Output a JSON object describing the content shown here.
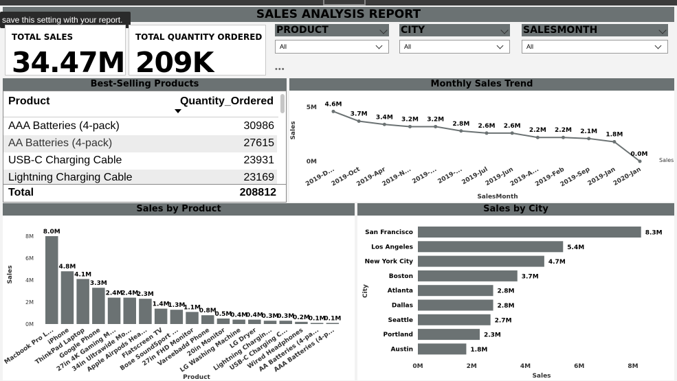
{
  "report": {
    "title": "SALES ANALYSIS REPORT"
  },
  "tooltip": {
    "text": "save this setting with your report."
  },
  "kpis": [
    {
      "label": "TOTAL SALES",
      "value": "34.47M"
    },
    {
      "label": "TOTAL QUANTITY ORDERED",
      "value": "209K"
    }
  ],
  "slicers": [
    {
      "label": "PRODUCT",
      "value": "All"
    },
    {
      "label": "CITY",
      "value": "All"
    },
    {
      "label": "SALESMONTH",
      "value": "All"
    }
  ],
  "best_selling": {
    "title": "Best-Selling Products",
    "columns": [
      "Product",
      "Quantity_Ordered"
    ],
    "rows": [
      {
        "product": "AAA Batteries (4-pack)",
        "qty": "30986"
      },
      {
        "product": "AA Batteries (4-pack)",
        "qty": "27615"
      },
      {
        "product": "USB-C Charging Cable",
        "qty": "23931"
      },
      {
        "product": "Lightning Charging Cable",
        "qty": "23169"
      }
    ],
    "total_label": "Total",
    "total_value": "208812"
  },
  "colors": {
    "bar": "#6b7273",
    "header": "#6b7273",
    "line": "#6b7273"
  },
  "chart_data": [
    {
      "type": "line",
      "title": "Monthly Sales Trend",
      "xlabel": "SalesMonth",
      "ylabel": "Sales",
      "yticks": [
        "5M",
        "0M"
      ],
      "ylim": [
        0,
        5
      ],
      "categories": [
        "2019-D...",
        "2019-Oct",
        "2019-Apr",
        "2019-N...",
        "2019-...",
        "2019-...",
        "2019-Jul",
        "2019-Jun",
        "2019-A...",
        "2019-Feb",
        "2019-Sep",
        "2019-Jan",
        "2020-Jan"
      ],
      "series": [
        {
          "name": "Sales",
          "values": [
            4.6,
            3.7,
            3.4,
            3.2,
            3.2,
            2.8,
            2.6,
            2.6,
            2.2,
            2.2,
            2.1,
            1.8,
            0.0
          ],
          "labels": [
            "4.6M",
            "3.7M",
            "3.4M",
            "3.2M",
            "3.2M",
            "2.8M",
            "2.6M",
            "2.6M",
            "2.2M",
            "2.2M",
            "2.1M",
            "1.8M",
            "0.0M"
          ]
        }
      ]
    },
    {
      "type": "bar",
      "title": "Sales by Product",
      "xlabel": "Product",
      "ylabel": "Sales",
      "yticks": [
        "0M",
        "2M",
        "4M",
        "6M",
        "8M"
      ],
      "ylim": [
        0,
        8.5
      ],
      "categories": [
        "Macbook Pro L...",
        "iPhone",
        "ThinkPad Laptop",
        "Google Phone",
        "27in 4K Gaming M...",
        "34in Ultrawide Mo...",
        "Apple Airpods Hea...",
        "Flatscreen TV",
        "Bose SoundSport ...",
        "27in FHD Monitor",
        "Vareebadd Phone",
        "20in Monitor",
        "LG Washing Machine",
        "LG Dryer",
        "Lightning Chargin...",
        "USB-C Charging C...",
        "Wired Headphones",
        "AA Batteries (4-pa...",
        "AAA Batteries (4-p..."
      ],
      "values": [
        8.0,
        4.8,
        4.1,
        3.3,
        2.4,
        2.4,
        2.3,
        1.4,
        1.3,
        1.1,
        0.8,
        0.5,
        0.4,
        0.4,
        0.3,
        0.3,
        0.2,
        0.1,
        0.1
      ],
      "labels": [
        "8.0M",
        "4.8M",
        "4.1M",
        "3.3M",
        "2.4M",
        "2.4M",
        "2.3M",
        "1.4M",
        "1.3M",
        "1.1M",
        "0.8M",
        "0.5M",
        "0.4M",
        "0.4M",
        "0.3M",
        "0.3M",
        "0.2M",
        "0.1M",
        "0.1M"
      ]
    },
    {
      "type": "bar",
      "orientation": "horizontal",
      "title": "Sales by City",
      "xlabel": "Sales",
      "ylabel": "City",
      "xticks": [
        "0M",
        "2M",
        "4M",
        "6M",
        "8M"
      ],
      "xlim": [
        0,
        8
      ],
      "categories": [
        "San Francisco",
        "Los Angeles",
        "New York City",
        "Boston",
        "Atlanta",
        "Dallas",
        "Seattle",
        "Portland",
        "Austin"
      ],
      "values": [
        8.3,
        5.4,
        4.7,
        3.7,
        2.8,
        2.8,
        2.7,
        2.3,
        1.8
      ],
      "labels": [
        "8.3M",
        "5.4M",
        "4.7M",
        "3.7M",
        "2.8M",
        "2.8M",
        "2.7M",
        "2.3M",
        "1.8M"
      ]
    }
  ]
}
